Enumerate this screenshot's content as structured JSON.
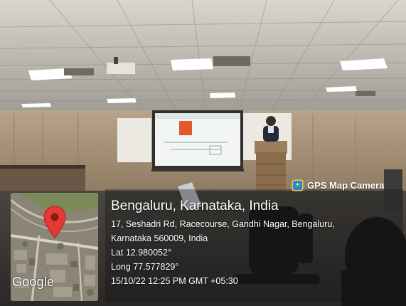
{
  "app_badge": {
    "label": "GPS Map Camera",
    "icon": "gps-map-camera-icon"
  },
  "location": {
    "title": "Bengaluru, Karnataka, India",
    "address_line_1": "17, Seshadri Rd, Racecourse, Gandhi Nagar, Bengaluru,",
    "address_line_2": "Karnataka 560009, India",
    "latitude": "Lat 12.980052°",
    "longitude": "Long 77.577829°",
    "timestamp": "15/10/22 12:25 PM GMT +05:30"
  },
  "map": {
    "attribution": "Google",
    "marker_color": "#e53935"
  }
}
